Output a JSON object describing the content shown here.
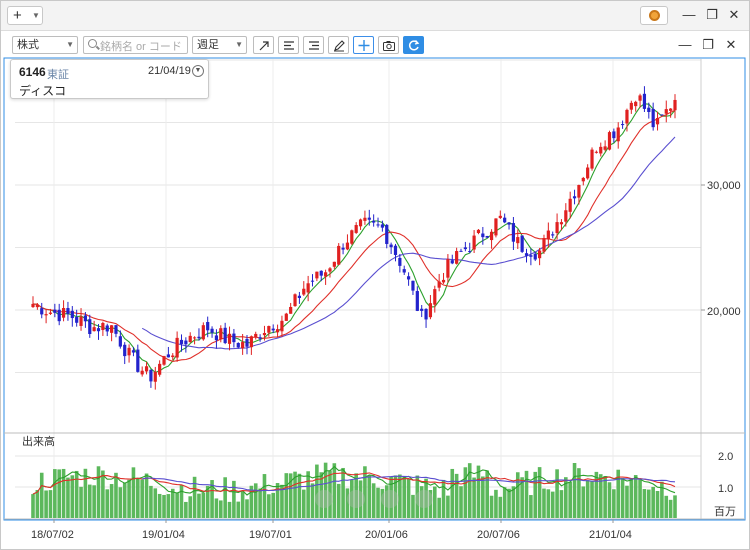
{
  "titlebar": {
    "add_button": "+",
    "settings_icon": "gear-icon",
    "minimize_icon": "minimize-icon",
    "restore_icon": "restore-icon",
    "close_icon": "close-icon"
  },
  "toolbar": {
    "asset_type": "株式",
    "search_placeholder": "銘柄名 or コード",
    "period": "週足",
    "tools": [
      "trendline-icon",
      "lines-icon",
      "lines-alt-icon",
      "draw-icon",
      "crosshair-icon",
      "camera-icon",
      "refresh-icon"
    ]
  },
  "info": {
    "code": "6146",
    "market": "東証",
    "date": "21/04/19",
    "name": "ディスコ"
  },
  "price_axis": {
    "ticks": [
      "30,000",
      "20,000"
    ]
  },
  "volume_panel": {
    "title": "出来高",
    "ticks": [
      "2.0",
      "1.0"
    ],
    "unit": "百万"
  },
  "x_axis": {
    "ticks": [
      "18/07/02",
      "19/01/04",
      "19/07/01",
      "20/01/06",
      "20/07/06",
      "21/01/04"
    ]
  },
  "colors": {
    "up": "#e02020",
    "down": "#2323cc",
    "ma_short": "#2ca02c",
    "ma_mid": "#e0302a",
    "ma_long": "#5a4fd0",
    "volume": "#5cb85c",
    "accent": "#2f8de4"
  },
  "chart_data": {
    "type": "candlestick",
    "period": "weekly",
    "y_unit": "JPY",
    "price_ticks": [
      20000,
      30000
    ],
    "volume_ticks": [
      1.0,
      2.0
    ],
    "volume_unit": "millions",
    "x_ticks": [
      "18/07/02",
      "19/01/04",
      "19/07/01",
      "20/01/06",
      "20/07/06",
      "21/01/04"
    ],
    "close_path": [
      {
        "x": "18/07/02",
        "y": 20500
      },
      {
        "x": "18/08",
        "y": 19800
      },
      {
        "x": "18/09",
        "y": 19500
      },
      {
        "x": "18/10",
        "y": 18600
      },
      {
        "x": "18/11",
        "y": 18800
      },
      {
        "x": "18/12",
        "y": 16200
      },
      {
        "x": "19/01/04",
        "y": 14600
      },
      {
        "x": "19/02",
        "y": 16600
      },
      {
        "x": "19/03",
        "y": 17800
      },
      {
        "x": "19/04",
        "y": 18600
      },
      {
        "x": "19/05",
        "y": 17600
      },
      {
        "x": "19/06",
        "y": 17200
      },
      {
        "x": "19/07/01",
        "y": 18700
      },
      {
        "x": "19/08",
        "y": 19400
      },
      {
        "x": "19/09",
        "y": 22000
      },
      {
        "x": "19/10",
        "y": 23000
      },
      {
        "x": "19/11",
        "y": 25500
      },
      {
        "x": "19/12",
        "y": 26800
      },
      {
        "x": "20/01/06",
        "y": 26500
      },
      {
        "x": "20/02",
        "y": 23500
      },
      {
        "x": "20/03",
        "y": 19200
      },
      {
        "x": "20/04",
        "y": 22800
      },
      {
        "x": "20/05",
        "y": 24600
      },
      {
        "x": "20/06",
        "y": 26000
      },
      {
        "x": "20/07/06",
        "y": 27300
      },
      {
        "x": "20/08",
        "y": 25200
      },
      {
        "x": "20/09",
        "y": 24600
      },
      {
        "x": "20/10",
        "y": 27200
      },
      {
        "x": "20/11",
        "y": 30000
      },
      {
        "x": "20/12",
        "y": 33300
      },
      {
        "x": "21/01/04",
        "y": 34500
      },
      {
        "x": "21/02",
        "y": 37400
      },
      {
        "x": "21/03",
        "y": 34500
      },
      {
        "x": "21/04/19",
        "y": 37000
      }
    ],
    "ma_short_color": "#2ca02c",
    "ma_mid_color": "#e0302a",
    "ma_long_color": "#5a4fd0"
  }
}
